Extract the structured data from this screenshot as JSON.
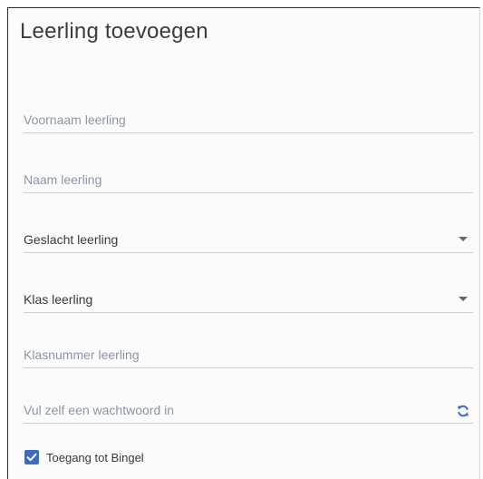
{
  "dialog": {
    "title": "Leerling toevoegen"
  },
  "form": {
    "first_name": {
      "placeholder": "Voornaam leerling",
      "value": ""
    },
    "last_name": {
      "placeholder": "Naam leerling",
      "value": ""
    },
    "gender": {
      "label": "Geslacht leerling",
      "selected": "",
      "icon": "caret-down-icon"
    },
    "class": {
      "label": "Klas leerling",
      "selected": "",
      "icon": "caret-down-icon"
    },
    "class_number": {
      "placeholder": "Klasnummer leerling",
      "value": ""
    },
    "password": {
      "placeholder": "Vul zelf een wachtwoord in",
      "value": "",
      "icon": "refresh-icon"
    },
    "bingel_access": {
      "label": "Toegang tot Bingel",
      "checked": true
    }
  },
  "colors": {
    "accent": "#3c6bc5",
    "placeholder": "#8a96a6",
    "underline": "#c9d2dd",
    "background": "#fbfbfb"
  }
}
